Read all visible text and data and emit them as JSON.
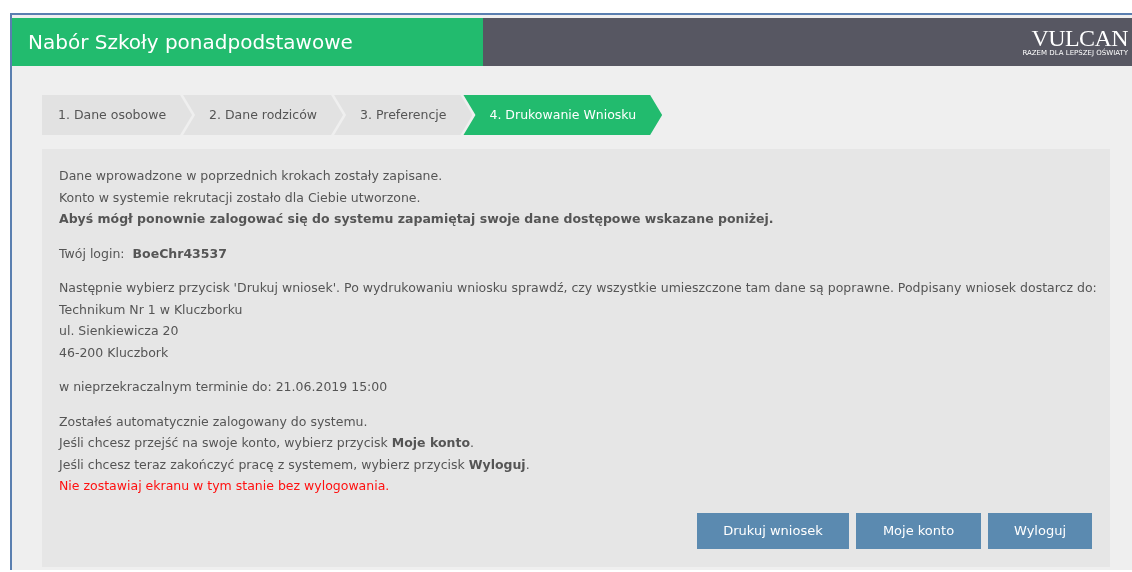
{
  "header": {
    "title": "Nabór Szkoły ponadpodstawowe",
    "logo": "VULCAN",
    "tagline": "RAZEM DLA LEPSZEJ OŚWIATY"
  },
  "steps": [
    {
      "label": "1. Dane osobowe",
      "selected": false
    },
    {
      "label": "2. Dane rodziców",
      "selected": false
    },
    {
      "label": "3. Preferencje",
      "selected": false
    },
    {
      "label": "4. Drukowanie Wniosku",
      "selected": true
    }
  ],
  "paragraphs": [
    [
      {
        "kind": "normal",
        "text": "Dane wprowadzone w poprzednich krokach zostały zapisane."
      },
      {
        "kind": "normal",
        "text": "Konto w systemie rekrutacji zostało dla Ciebie utworzone."
      },
      {
        "kind": "bold",
        "text": "Abyś mógł ponownie zalogować się do systemu zapamiętaj swoje dane dostępowe wskazane poniżej."
      }
    ],
    [
      {
        "kind": "login",
        "label": "Twój login:",
        "value": "BoeChr43537"
      }
    ],
    [
      {
        "kind": "normal",
        "text": "Następnie wybierz przycisk 'Drukuj wniosek'. Po wydrukowaniu wniosku sprawdź, czy wszystkie umieszczone tam dane są poprawne. Podpisany wniosek dostarcz do:"
      },
      {
        "kind": "normal",
        "text": "Technikum Nr 1 w Kluczborku"
      },
      {
        "kind": "normal",
        "text": "ul. Sienkiewicza 20"
      },
      {
        "kind": "normal",
        "text": "46-200 Kluczbork"
      }
    ],
    [
      {
        "kind": "normal",
        "text": "w nieprzekraczalnym terminie do: 21.06.2019 15:00"
      }
    ],
    [
      {
        "kind": "normal",
        "text": "Zostałeś automatycznie zalogowany do systemu."
      },
      {
        "kind": "normal",
        "text": "Jeśli chcesz przejść na swoje konto, wybierz przycisk **Moje konto**."
      },
      {
        "kind": "normal",
        "text": "Jeśli chcesz teraz zakończyć pracę z systemem, wybierz przycisk **Wyloguj**."
      },
      {
        "kind": "warning",
        "text": "Nie zostawiaj ekranu w tym stanie bez wylogowania."
      }
    ]
  ],
  "buttons": [
    "Drukuj wniosek",
    "Moje konto",
    "Wyloguj"
  ]
}
